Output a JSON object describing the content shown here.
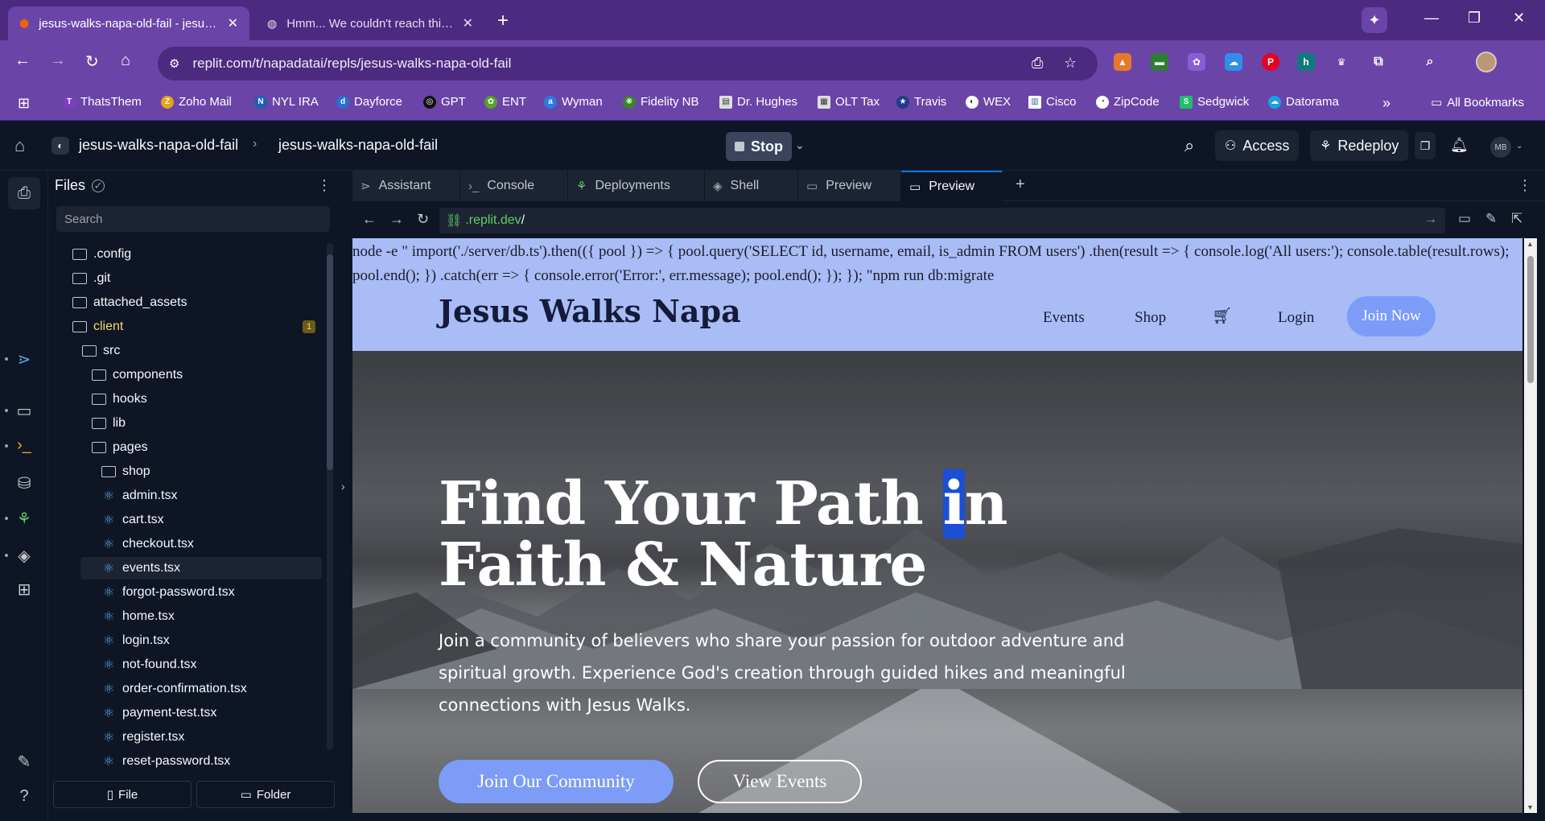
{
  "browser": {
    "tabs": [
      {
        "title": "jesus-walks-napa-old-fail - jesus-walks-napa-old-fail",
        "active": true
      },
      {
        "title": "Hmm... We couldn't reach this app",
        "active": false
      }
    ],
    "new_tab": "+",
    "url": "replit.com/t/napadatai/repls/jesus-walks-napa-old-fail",
    "bookmarks": [
      "ThatsThem",
      "Zoho Mail",
      "NYL IRA",
      "Dayforce",
      "GPT",
      "ENT",
      "Wyman",
      "Fidelity NB",
      "Dr. Hughes",
      "OLT Tax",
      "Travis",
      "WEX",
      "Cisco",
      "ZipCode",
      "Sedgwick",
      "Datorama"
    ],
    "bookmarks_overflow": "»",
    "all_bookmarks": "All Bookmarks",
    "profile_initials": "MB"
  },
  "replit": {
    "breadcrumb": [
      "jesus-walks-napa-old-fail",
      "jesus-walks-napa-old-fail"
    ],
    "breadcrumb_sep": "›",
    "stop_label": "Stop",
    "access_label": "Access",
    "redeploy_label": "Redeploy"
  },
  "files": {
    "title": "Files",
    "search_placeholder": "Search",
    "tree": [
      {
        "label": ".config",
        "type": "folder",
        "depth": 0
      },
      {
        "label": ".git",
        "type": "folder",
        "depth": 0
      },
      {
        "label": "attached_assets",
        "type": "folder",
        "depth": 0
      },
      {
        "label": "client",
        "type": "folder-open",
        "depth": 0,
        "badge": "1"
      },
      {
        "label": "src",
        "type": "folder-open",
        "depth": 1
      },
      {
        "label": "components",
        "type": "folder",
        "depth": 2
      },
      {
        "label": "hooks",
        "type": "folder",
        "depth": 2
      },
      {
        "label": "lib",
        "type": "folder",
        "depth": 2
      },
      {
        "label": "pages",
        "type": "folder-open",
        "depth": 2
      },
      {
        "label": "shop",
        "type": "folder",
        "depth": 3
      },
      {
        "label": "admin.tsx",
        "type": "file",
        "depth": 3
      },
      {
        "label": "cart.tsx",
        "type": "file",
        "depth": 3
      },
      {
        "label": "checkout.tsx",
        "type": "file",
        "depth": 3
      },
      {
        "label": "events.tsx",
        "type": "file",
        "depth": 3,
        "selected": true
      },
      {
        "label": "forgot-password.tsx",
        "type": "file",
        "depth": 3
      },
      {
        "label": "home.tsx",
        "type": "file",
        "depth": 3
      },
      {
        "label": "login.tsx",
        "type": "file",
        "depth": 3
      },
      {
        "label": "not-found.tsx",
        "type": "file",
        "depth": 3
      },
      {
        "label": "order-confirmation.tsx",
        "type": "file",
        "depth": 3
      },
      {
        "label": "payment-test.tsx",
        "type": "file",
        "depth": 3
      },
      {
        "label": "register.tsx",
        "type": "file",
        "depth": 3
      },
      {
        "label": "reset-password.tsx",
        "type": "file",
        "depth": 3
      }
    ],
    "new_file_label": "File",
    "new_folder_label": "Folder"
  },
  "workspace_tabs": [
    {
      "label": "Assistant",
      "icon": "assistant-icon"
    },
    {
      "label": "Console",
      "icon": "console-icon"
    },
    {
      "label": "Deployments",
      "icon": "deployments-icon"
    },
    {
      "label": "Shell",
      "icon": "shell-icon"
    },
    {
      "label": "Preview",
      "icon": "preview-icon"
    },
    {
      "label": "Preview",
      "icon": "preview-icon",
      "active": true
    }
  ],
  "preview_bar": {
    "domain": ".replit.dev",
    "path": "/"
  },
  "site": {
    "command_text": "node -e \" import('./server/db.ts').then(({ pool }) => { pool.query('SELECT id, username, email, is_admin FROM users') .then(result => { console.log('All users:'); console.table(result.rows); pool.end(); }) .catch(err => { console.error('Error:', err.message); pool.end(); }); }); \"npm run db:migrate",
    "brand": "Jesus Walks Napa",
    "nav": [
      "Events",
      "Shop",
      "Login"
    ],
    "join_now": "Join Now",
    "hero_title_a": "Find Your Path ",
    "hero_title_hl": "i",
    "hero_title_b": "n Faith & Nature",
    "hero_subtitle": "Join a community of believers who share your passion for outdoor adventure and spiritual growth. Experience God's creation through guided hikes and meaningful connections with Jesus Walks.",
    "cta_primary": "Join Our Community",
    "cta_secondary": "View Events"
  },
  "colors": {
    "chrome_purple": "#6b44a8",
    "replit_bg": "#0e1525",
    "site_header": "#a9bcf5",
    "site_accent": "#7c9cf8"
  }
}
